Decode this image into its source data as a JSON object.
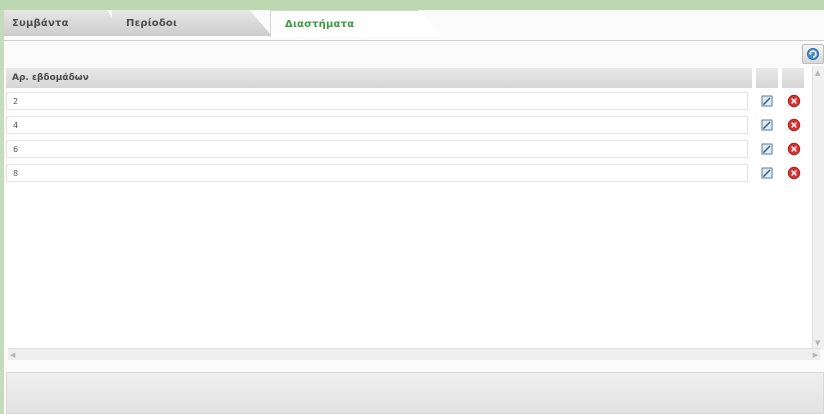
{
  "tabs": [
    {
      "label": "Συμβάντα",
      "active": false
    },
    {
      "label": "Περίοδοι",
      "active": false
    },
    {
      "label": "Διαστήματα",
      "active": true
    }
  ],
  "toolbar": {
    "refresh_icon": "refresh-icon"
  },
  "grid": {
    "column_header": "Αρ. εβδομάδων",
    "rows": [
      {
        "value": "2"
      },
      {
        "value": "4"
      },
      {
        "value": "6"
      },
      {
        "value": "8"
      }
    ],
    "row_icons": {
      "edit": "edit-icon",
      "delete": "delete-icon"
    }
  },
  "colors": {
    "active_tab_text": "#3d9a44",
    "frame": "#c4dcbc",
    "delete": "#d23232"
  }
}
